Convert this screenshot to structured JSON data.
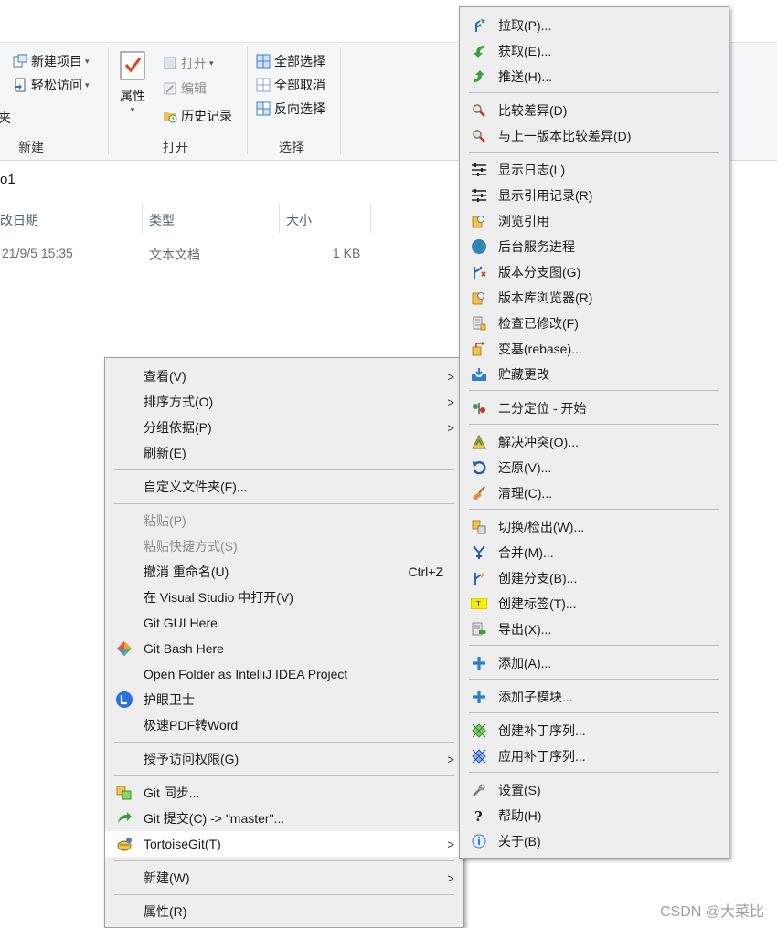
{
  "ribbon": {
    "new_item": "新建项目",
    "easy_access": "轻松访问",
    "partial_left": "夹",
    "group_new": "新建",
    "properties": "属性",
    "open": "打开",
    "edit": "编辑",
    "history": "历史记录",
    "group_open": "打开",
    "select_all": "全部选择",
    "select_none": "全部取消",
    "invert_select": "反向选择",
    "group_select": "选择"
  },
  "address": {
    "text": "o1"
  },
  "list": {
    "headers": [
      "改日期",
      "类型",
      "大小"
    ],
    "row": {
      "date": "21/9/5 15:35",
      "type": "文本文档",
      "size": "1 KB"
    }
  },
  "context_menu": {
    "items": [
      "查看(V)",
      "排序方式(O)",
      "分组依据(P)",
      "刷新(E)",
      "自定义文件夹(F)...",
      "粘贴(P)",
      "粘贴快捷方式(S)",
      "撤消 重命名(U)",
      "在 Visual Studio 中打开(V)",
      "Git GUI Here",
      "Git Bash Here",
      "Open Folder as IntelliJ IDEA Project",
      "护眼卫士",
      "极速PDF转Word",
      "授予访问权限(G)",
      "Git 同步...",
      "Git 提交(C) -> \"master\"...",
      "TortoiseGit(T)",
      "新建(W)",
      "属性(R)"
    ],
    "undo_shortcut": "Ctrl+Z"
  },
  "submenu": {
    "items": [
      "拉取(P)...",
      "获取(E)...",
      "推送(H)...",
      "比较差异(D)",
      "与上一版本比较差异(D)",
      "显示日志(L)",
      "显示引用记录(R)",
      "浏览引用",
      "后台服务进程",
      "版本分支图(G)",
      "版本库浏览器(R)",
      "检查已修改(F)",
      "变基(rebase)...",
      "贮藏更改",
      "二分定位 - 开始",
      "解决冲突(O)...",
      "还原(V)...",
      "清理(C)...",
      "切换/检出(W)...",
      "合并(M)...",
      "创建分支(B)...",
      "创建标签(T)...",
      "导出(X)...",
      "添加(A)...",
      "添加子模块...",
      "创建补丁序列...",
      "应用补丁序列...",
      "设置(S)",
      "帮助(H)",
      "关于(B)"
    ]
  },
  "watermark": "CSDN @大菜比"
}
